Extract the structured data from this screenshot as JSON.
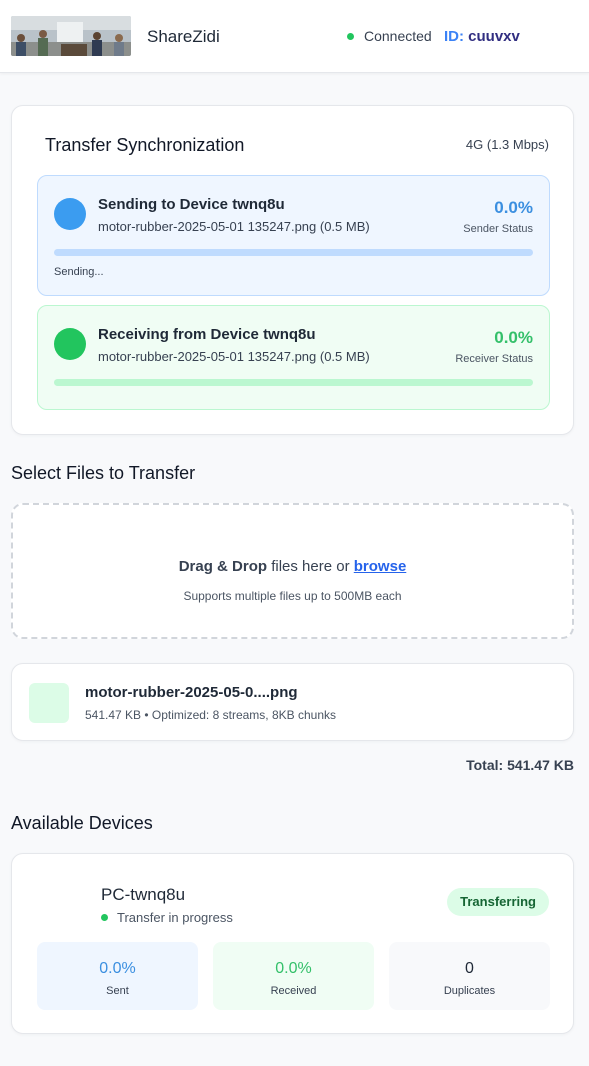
{
  "header": {
    "app_name": "ShareZidi",
    "connection_status": "Connected",
    "id_label": "ID:",
    "id_value": "cuuvxv"
  },
  "sync": {
    "title": "Transfer Synchronization",
    "network": "4G (1.3 Mbps)",
    "sender": {
      "title": "Sending to Device twnq8u",
      "file": "motor-rubber-2025-05-01 135247.png (0.5 MB)",
      "percent": "0.0%",
      "progress": 0.0,
      "status_label": "Sender Status",
      "substatus": "Sending..."
    },
    "receiver": {
      "title": "Receiving from Device twnq8u",
      "file": "motor-rubber-2025-05-01 135247.png (0.5 MB)",
      "percent": "0.0%",
      "progress": 0.0,
      "status_label": "Receiver Status"
    }
  },
  "files": {
    "title": "Select Files to Transfer",
    "drop_strong": "Drag & Drop",
    "drop_text": " files here or ",
    "browse": "browse",
    "drop_hint": "Supports multiple files up to 500MB each",
    "items": [
      {
        "name": "motor-rubber-2025-05-0....png",
        "meta": "541.47 KB • Optimized: 8 streams, 8KB chunks"
      }
    ],
    "total": "Total: 541.47 KB"
  },
  "devices": {
    "title": "Available Devices",
    "items": [
      {
        "name": "PC-twnq8u",
        "state": "Transfer in progress",
        "badge": "Transferring",
        "sent_value": "0.0%",
        "sent_label": "Sent",
        "received_value": "0.0%",
        "received_label": "Received",
        "duplicates_value": "0",
        "duplicates_label": "Duplicates"
      }
    ]
  }
}
